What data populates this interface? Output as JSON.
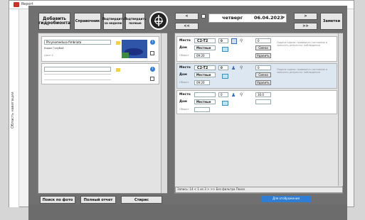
{
  "window": {
    "title": "Report",
    "side_label": "Область навигации"
  },
  "toolbar": {
    "add_label": "Добавить гидробионта",
    "reference_label": "Справочник",
    "confirm_week_label": "Подтвердить за неделю",
    "confirm_full_label": "Подтвердить полные",
    "prev_top": "<",
    "prev_bottom": "<<",
    "day": "четверг",
    "date": "06.04.2023",
    "next_top": ">",
    "next_bottom": ">>",
    "notes_label": "Заметки"
  },
  "left": {
    "row1": {
      "name_value": "Phrynomedusa fimbriata",
      "sub_value": "Корал Голубой",
      "note_value": "Цикл 4"
    }
  },
  "cards": [
    {
      "place_label": "Место",
      "place_value": "C2-T2",
      "num_value": "0",
      "house_label": "Дом",
      "house_value": "Местные",
      "time_label": "Оборот",
      "time_value": "09:20",
      "side_value": "0",
      "btn1": "Смена",
      "btn2": "Удалить",
      "note": "Подача корма: проверить состояние и записать результат наблюдения"
    },
    {
      "place_label": "Место",
      "place_value": "C2-T2",
      "num_value": "0",
      "house_label": "Дом",
      "house_value": "Местные",
      "time_label": "Оборот",
      "time_value": "09:20",
      "side_value": "0",
      "btn1": "Смена",
      "btn2": "Удалить",
      "note": "Подача корма: проверить состояние и записать результат наблюдения"
    },
    {
      "place_label": "Место",
      "place_value": "",
      "num_value": "0",
      "house_label": "Дом",
      "house_value": "Местные",
      "time_label": "Оборот",
      "time_value": "",
      "side_value": "30.0",
      "btn1": "",
      "btn2": "",
      "note": ""
    }
  ],
  "status": {
    "record_text": "Запись: 14 < 1 из 3 > >> Без фильтра Поиск"
  },
  "bottom": {
    "search_photo": "Поиск по фото",
    "full_report": "Полный отчет",
    "styles": "Стирис",
    "blue_label": "Для отображения"
  },
  "icons": {
    "logo": "logo-emblem",
    "calendar": "calendar-icon",
    "info": "info-icon"
  }
}
